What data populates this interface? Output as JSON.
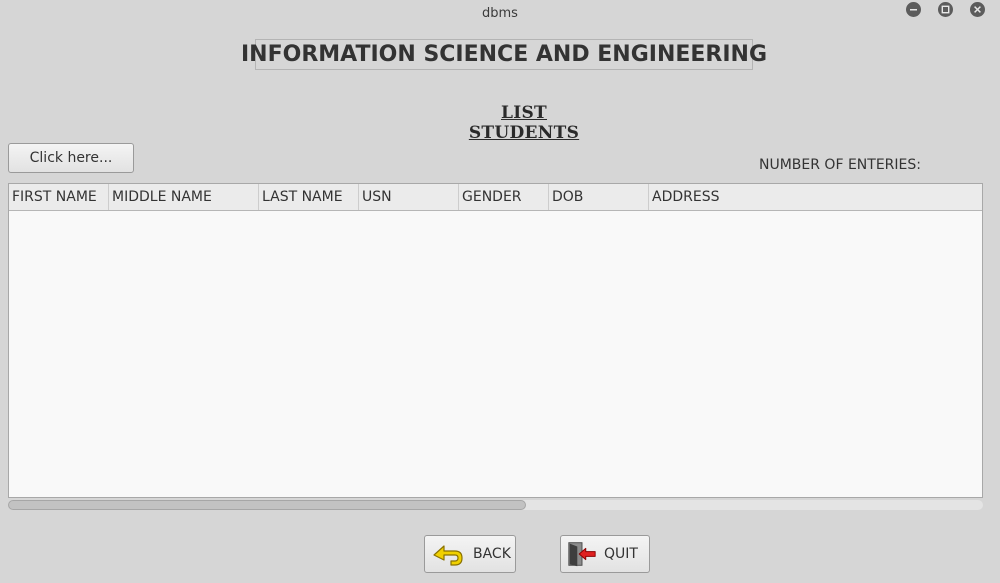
{
  "window": {
    "title": "dbms",
    "controls": {
      "minimize_icon": "minimize-icon",
      "maximize_icon": "maximize-icon",
      "close_icon": "close-icon"
    }
  },
  "header": {
    "department": "INFORMATION SCIENCE AND ENGINEERING",
    "page_title": "LIST STUDENTS"
  },
  "toolbar": {
    "click_button_label": "Click here...",
    "count_label": "NUMBER OF ENTERIES:"
  },
  "table": {
    "columns": [
      "FIRST NAME",
      "MIDDLE NAME",
      "LAST NAME",
      "USN",
      "GENDER",
      "DOB",
      "ADDRESS"
    ],
    "rows": []
  },
  "footer": {
    "back_label": "BACK",
    "back_icon": "back-arrow-icon",
    "quit_label": "QUIT",
    "quit_icon": "exit-door-icon"
  },
  "colors": {
    "background": "#d6d6d6",
    "table_background": "#f9f9f9",
    "window_control": "#5c5c5c",
    "back_arrow": "#e8c400",
    "quit_arrow": "#d42020"
  }
}
